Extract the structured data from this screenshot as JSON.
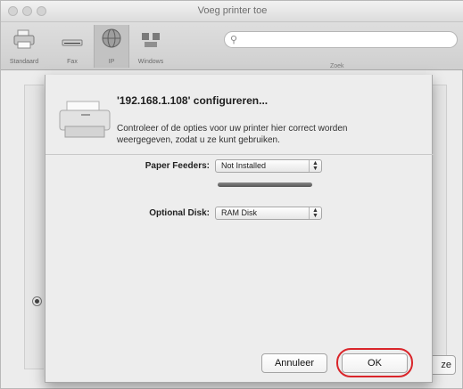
{
  "window": {
    "title": "Voeg printer toe"
  },
  "toolbar": {
    "items": [
      {
        "label": "Standaard",
        "icon": "printer-icon"
      },
      {
        "label": "Fax",
        "icon": "fax-icon"
      },
      {
        "label": "IP",
        "icon": "globe-icon"
      },
      {
        "label": "Windows",
        "icon": "windows-network-icon"
      }
    ],
    "search_placeholder": "",
    "search_label": "Zoek"
  },
  "dialog": {
    "title": "'192.168.1.108' configureren...",
    "description": "Controleer of de opties voor uw printer hier correct worden weergegeven, zodat u ze kunt gebruiken.",
    "fields": [
      {
        "label": "Paper Feeders:",
        "value": "Not Installed"
      },
      {
        "label": "Optional Disk:",
        "value": "RAM Disk"
      }
    ],
    "cancel_label": "Annuleer",
    "ok_label": "OK"
  },
  "background": {
    "cut_button_label": "ze"
  },
  "colors": {
    "highlight": "#d9252a"
  }
}
